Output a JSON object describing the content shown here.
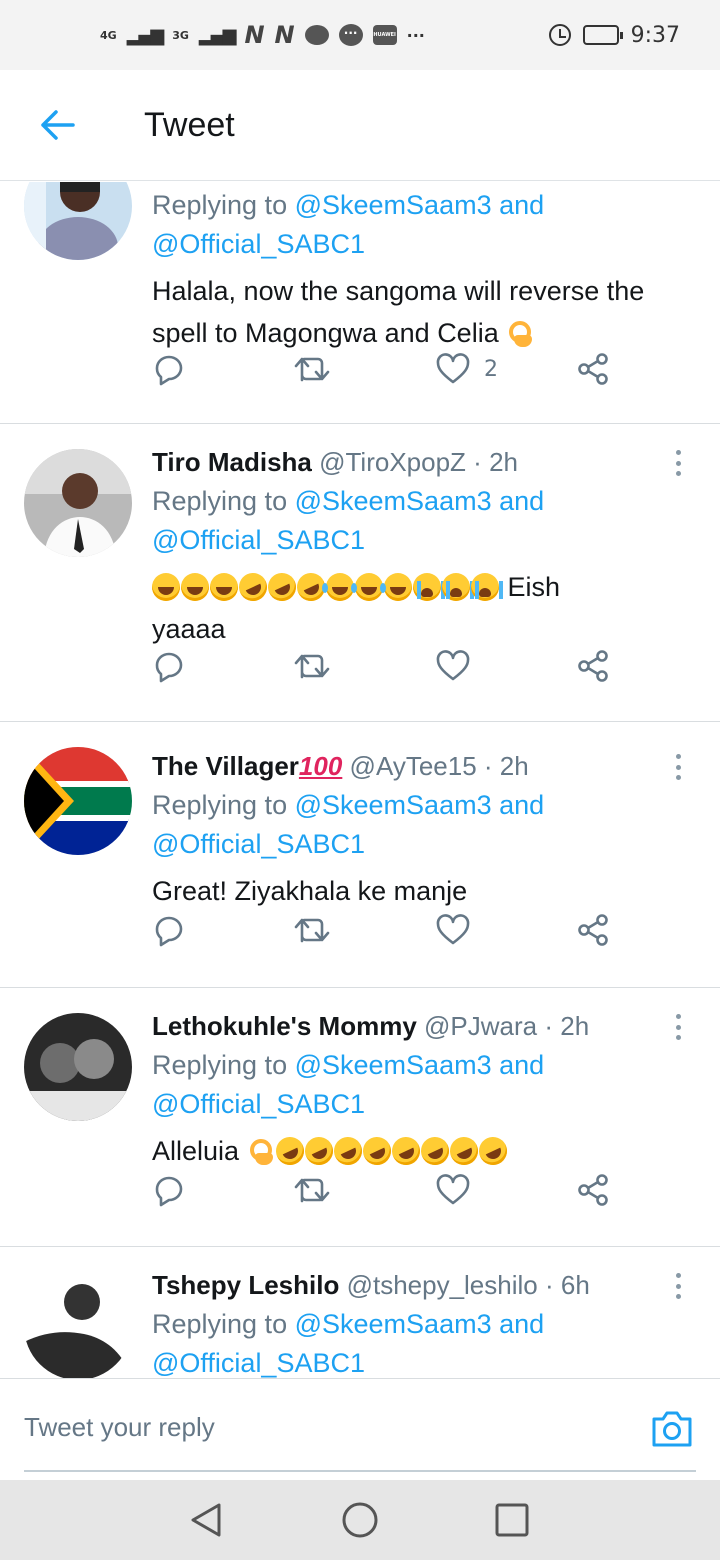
{
  "status_bar": {
    "network_1": "4G",
    "network_2": "3G",
    "time": "9:37",
    "overflow": "···",
    "notification_icons": [
      "n-icon",
      "n-icon",
      "message-icon",
      "chat-icon",
      "huawei-icon"
    ]
  },
  "header": {
    "title": "Tweet",
    "back_icon": "arrow-left-icon",
    "accent_color": "#1da1f2"
  },
  "tweets": [
    {
      "name": "",
      "handle": "",
      "time": "",
      "replying_label": "Replying to",
      "mention_1": "@SkeemSaam3",
      "and": "and",
      "mention_2": "@Official_SABC1",
      "text": "Halala, now the sangoma will reverse the spell to Magongwa and Celia",
      "emoji": [
        "ok-hand"
      ],
      "likes": "2"
    },
    {
      "name": "Tiro Madisha",
      "handle": "@TiroXpopZ",
      "dot": "·",
      "time": "2h",
      "replying_label": "Replying to",
      "mention_1": "@SkeemSaam3",
      "and": "and",
      "mention_2": "@Official_SABC1",
      "text_after_emoji": "Eish",
      "text_line2": "yaaaa",
      "emoji": [
        "laugh",
        "laugh",
        "laugh",
        "rofl",
        "rofl",
        "rofl",
        "joy",
        "joy",
        "joy",
        "sob",
        "sob",
        "sob"
      ],
      "likes": ""
    },
    {
      "name": "The Villager",
      "name_badge": "100",
      "handle": "@AyTee15",
      "dot": "·",
      "time": "2h",
      "replying_label": "Replying to",
      "mention_1": "@SkeemSaam3",
      "and": "and",
      "mention_2": "@Official_SABC1",
      "text": "Great! Ziyakhala ke manje",
      "likes": ""
    },
    {
      "name": "Lethokuhle's Mommy",
      "handle": "@PJwara",
      "dot": "·",
      "time": "2h",
      "replying_label": "Replying to",
      "mention_1": "@SkeemSaam3",
      "and": "and",
      "mention_2": "@Official_SABC1",
      "text": "Alleluia",
      "emoji": [
        "ok-hand",
        "rofl",
        "rofl",
        "rofl",
        "rofl",
        "rofl",
        "rofl",
        "rofl",
        "rofl"
      ],
      "likes": ""
    },
    {
      "name": "Tshepy Leshilo",
      "handle": "@tshepy_leshilo",
      "dot": "·",
      "time": "6h",
      "replying_label": "Replying to",
      "mention_1": "@SkeemSaam3",
      "and": "and",
      "mention_2": "@Official_SABC1"
    }
  ],
  "action_icons": [
    "reply-icon",
    "retweet-icon",
    "like-icon",
    "share-icon"
  ],
  "reply_bar": {
    "placeholder": "Tweet your reply",
    "camera_icon": "camera-icon"
  },
  "nav_bar": {
    "buttons": [
      "back-triangle-icon",
      "home-circle-icon",
      "recents-square-icon"
    ]
  }
}
